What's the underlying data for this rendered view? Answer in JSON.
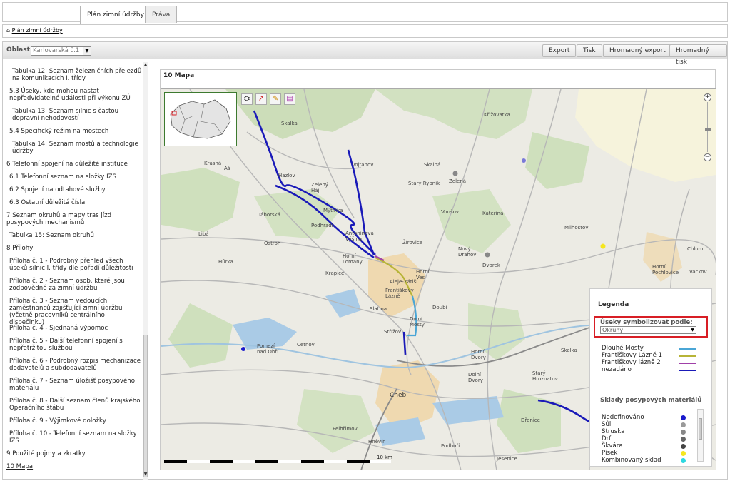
{
  "tabs": [
    {
      "label": "Plán zimní údržby"
    },
    {
      "label": "Práva"
    }
  ],
  "breadcrumb": {
    "home_icon": "home-icon",
    "label": "Plán zimní údržby"
  },
  "toolbar": {
    "oblast_label": "Oblast",
    "oblast_value": "Karlovarská č.1",
    "buttons": [
      "Export",
      "Tisk",
      "Hromadný export",
      "Hromadný tisk"
    ]
  },
  "nav": {
    "items": [
      "Tabulka 12: Seznam železničních přejezdů na komunikacích I. třídy",
      "5.3 Úseky, kde mohou nastat nepředvídatelné události při výkonu ZÚ",
      "Tabulka 13: Seznam silnic s častou dopravní nehodovostí",
      "5.4 Specifický režim na mostech",
      "Tabulka 14: Seznam mostů a technologie údržby",
      "6 Telefonní spojení na důležité instituce",
      "6.1 Telefonní seznam na složky IZS",
      "6.2 Spojení na odtahové služby",
      "6.3 Ostatní důležitá čísla",
      "7 Seznam okruhů a mapy tras jízd posypových mechanismů",
      "Tabulka 15: Seznam okruhů",
      "8 Přílohy",
      "Příloha č. 1 - Podrobný přehled všech úseků silnic I. třídy dle pořadí důležitosti",
      "Příloha č. 2 - Seznam osob, které jsou zodpovědné za zimní údržbu",
      "Příloha č. 3 - Seznam vedoucích zaměstnanců zajišťující zimní údržbu (včetně pracovníků centrálního dispečinku)",
      "Příloha č. 4 - Sjednaná výpomoc",
      "Příloha č. 5 - Další telefonní spojení s nepřetržitou službou",
      "Příloha č. 6 - Podrobný rozpis mechanizace dodavatelů a subdodavatelů",
      "Příloha č. 7 - Seznam úložišť posypového materiálu",
      "Příloha č. 8 - Další seznam členů krajského Operačního štábu",
      "Příloha č. 9 - Výjimkové doložky",
      "Příloha č. 10 - Telefonní seznam na složky IZS",
      "9 Použité pojmy a zkratky",
      "10 Mapa"
    ]
  },
  "map": {
    "title": "10 Mapa",
    "scale_label": "10 km",
    "tools": [
      "layers-icon",
      "measure-icon",
      "info-icon",
      "print-icon"
    ],
    "places": [
      "Skalka",
      "Krásná",
      "Aš",
      "Hazlov",
      "Vojtanov",
      "Zelený Háj",
      "Mýtinka",
      "Táborská",
      "Podhradí",
      "Libá",
      "Ostroh",
      "Hůrka",
      "Krapice",
      "Horní Lomany",
      "Antonínova Výšina",
      "Aleje-Zátiší",
      "Františkovy Lázně",
      "Žírovice",
      "Slatina",
      "Křižovatka",
      "Skalná",
      "Zelená",
      "Starý Rybník",
      "Vonšov",
      "Kateřina",
      "Milhostov",
      "Nový Drahov",
      "Dvorek",
      "Horní Ves",
      "Doubí",
      "Dolní Mosty",
      "Střížov",
      "Pomezí nad Ohří",
      "Cetnov",
      "Cheb",
      "Horní Dvory",
      "Dolní Dvory",
      "Hněvín",
      "Podhoří",
      "Pelhřimov",
      "Dřenice",
      "Chlum",
      "Horní Pochlovice",
      "Vackov",
      "Skalka",
      "Jesenice",
      "Starý Hroznatov"
    ]
  },
  "legend": {
    "title": "Legenda",
    "subtitle": "Úseky symbolizovat podle:",
    "select_value": "Okruhy",
    "routes": [
      {
        "label": "Dlouhé Mosty",
        "color": "#4aa6d6"
      },
      {
        "label": "Františkovy Lázně 1",
        "color": "#b7b437"
      },
      {
        "label": "Františkovy lázně 2",
        "color": "#a040a8"
      },
      {
        "label": "nezadáno",
        "color": "#1a1ab8"
      }
    ],
    "materials_title": "Sklady posypových materiálů",
    "materials": [
      {
        "label": "Nedefinováno",
        "color": "#1a1acc"
      },
      {
        "label": "Sůl",
        "color": "#9a9a9a"
      },
      {
        "label": "Struska",
        "color": "#888888"
      },
      {
        "label": "Drť",
        "color": "#666666"
      },
      {
        "label": "Škvára",
        "color": "#444444"
      },
      {
        "label": "Písek",
        "color": "#f5e61e"
      },
      {
        "label": "Kombinovaný sklad",
        "color": "#2ed8e0"
      }
    ]
  },
  "colors": {
    "accent_red": "#d81e25",
    "route_blue": "#1a1ab8"
  }
}
